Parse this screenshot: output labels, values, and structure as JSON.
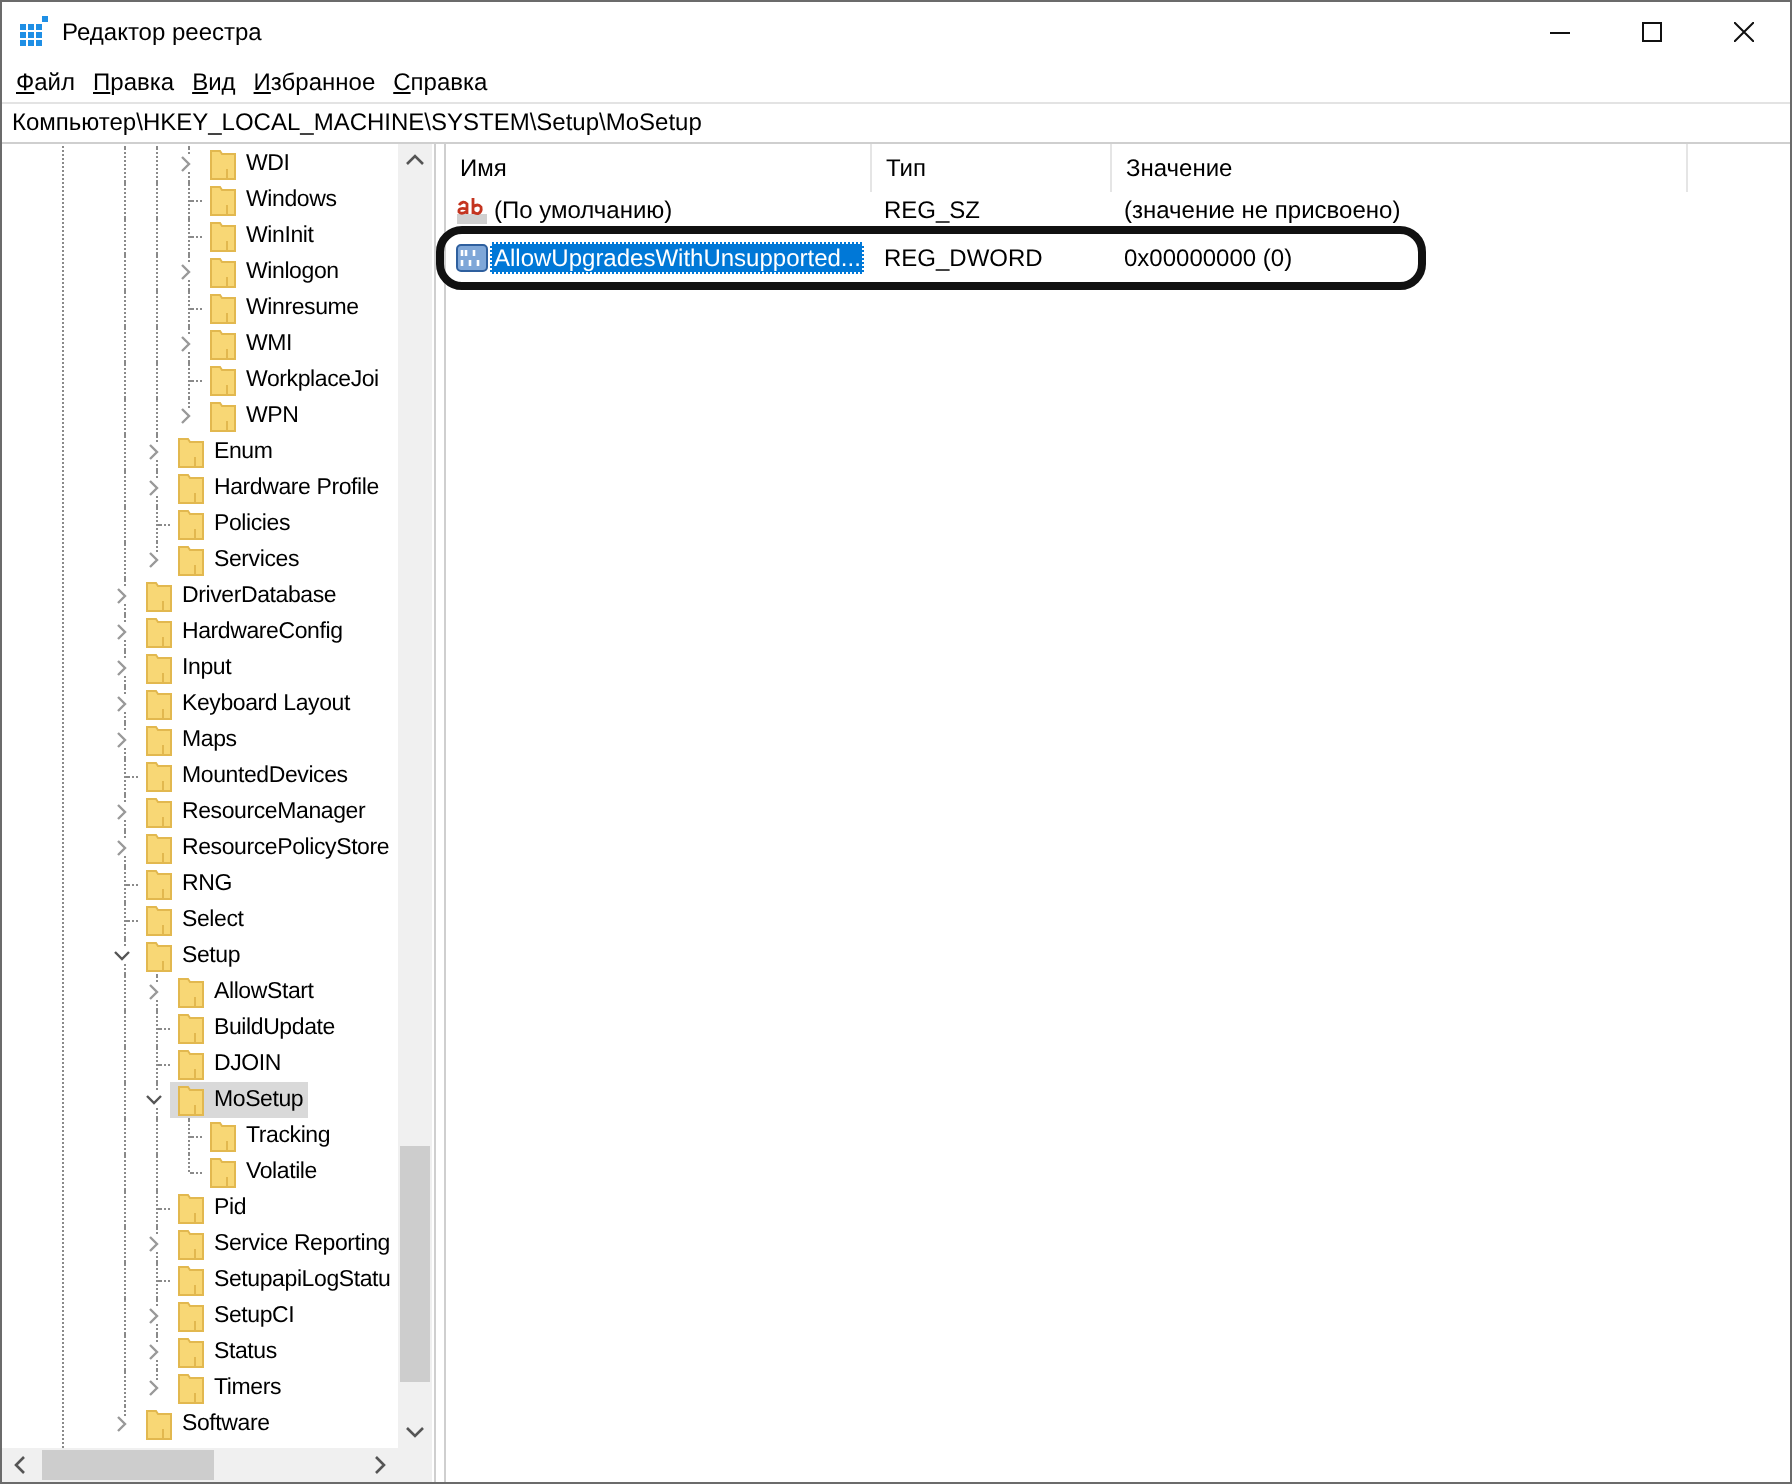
{
  "window": {
    "title": "Редактор реестра"
  },
  "menu": [
    {
      "label": "Файл"
    },
    {
      "label": "Правка"
    },
    {
      "label": "Вид"
    },
    {
      "label": "Избранное"
    },
    {
      "label": "Справка"
    }
  ],
  "address": "Компьютер\\HKEY_LOCAL_MACHINE\\SYSTEM\\Setup\\MoSetup",
  "tree": [
    {
      "children": [
        {
          "children": [
            {
              "label": "WDI",
              "kind": "collapsed",
              "selected": false
            },
            {
              "label": "Windows",
              "kind": "leaf",
              "selected": false
            },
            {
              "label": "WinInit",
              "kind": "leaf",
              "selected": false
            },
            {
              "label": "Winlogon",
              "kind": "collapsed",
              "selected": false
            },
            {
              "label": "Winresume",
              "kind": "leaf",
              "selected": false
            },
            {
              "label": "WMI",
              "kind": "collapsed",
              "selected": false
            },
            {
              "label": "WorkplaceJoi",
              "kind": "leaf",
              "selected": false
            },
            {
              "label": "WPN",
              "kind": "collapsed",
              "selected": false
            }
          ]
        },
        {
          "label": "Enum",
          "kind": "collapsed",
          "selected": false
        },
        {
          "label": "Hardware Profile",
          "kind": "collapsed",
          "selected": false
        },
        {
          "label": "Policies",
          "kind": "leaf",
          "selected": false
        },
        {
          "label": "Services",
          "kind": "collapsed",
          "selected": false
        }
      ]
    },
    {
      "label": "DriverDatabase",
      "kind": "collapsed",
      "selected": false
    },
    {
      "label": "HardwareConfig",
      "kind": "collapsed",
      "selected": false
    },
    {
      "label": "Input",
      "kind": "collapsed",
      "selected": false
    },
    {
      "label": "Keyboard Layout",
      "kind": "collapsed",
      "selected": false
    },
    {
      "label": "Maps",
      "kind": "collapsed",
      "selected": false
    },
    {
      "label": "MountedDevices",
      "kind": "leaf",
      "selected": false
    },
    {
      "label": "ResourceManager",
      "kind": "collapsed",
      "selected": false
    },
    {
      "label": "ResourcePolicyStore",
      "kind": "collapsed",
      "selected": false
    },
    {
      "label": "RNG",
      "kind": "leaf",
      "selected": false
    },
    {
      "label": "Select",
      "kind": "leaf",
      "selected": false
    },
    {
      "label": "Setup",
      "kind": "expanded",
      "selected": false,
      "children": [
        {
          "label": "AllowStart",
          "kind": "collapsed",
          "selected": false
        },
        {
          "label": "BuildUpdate",
          "kind": "leaf",
          "selected": false
        },
        {
          "label": "DJOIN",
          "kind": "leaf",
          "selected": false
        },
        {
          "label": "MoSetup",
          "kind": "expanded",
          "selected": true,
          "children": [
            {
              "label": "Tracking",
              "kind": "leaf",
              "selected": false
            },
            {
              "label": "Volatile",
              "kind": "leaf",
              "selected": false
            }
          ]
        },
        {
          "label": "Pid",
          "kind": "leaf",
          "selected": false
        },
        {
          "label": "Service Reporting",
          "kind": "collapsed",
          "selected": false
        },
        {
          "label": "SetupapiLogStatu",
          "kind": "leaf",
          "selected": false
        },
        {
          "label": "SetupCI",
          "kind": "collapsed",
          "selected": false
        },
        {
          "label": "Status",
          "kind": "collapsed",
          "selected": false
        },
        {
          "label": "Timers",
          "kind": "collapsed",
          "selected": false
        }
      ]
    },
    {
      "label": "Software",
      "kind": "collapsed",
      "selected": false
    }
  ],
  "columns": [
    "Имя",
    "Тип",
    "Значение"
  ],
  "values": [
    {
      "kind": "string",
      "name": "(По умолчанию)",
      "type": "REG_SZ",
      "data": "(значение не присвоено)",
      "selected": false,
      "highlighted": false
    },
    {
      "kind": "dword",
      "name": "AllowUpgradesWithUnsupported...",
      "type": "REG_DWORD",
      "data": "0x00000000 (0)",
      "selected": true,
      "highlighted": true
    }
  ]
}
